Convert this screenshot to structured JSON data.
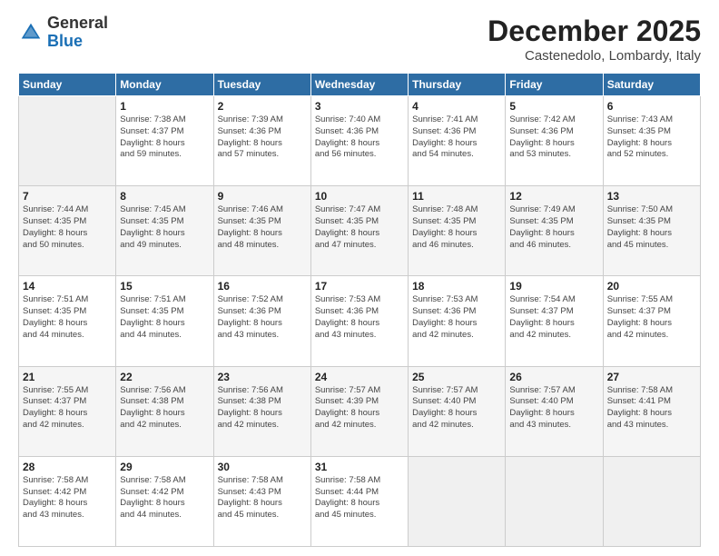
{
  "header": {
    "logo_general": "General",
    "logo_blue": "Blue",
    "month_title": "December 2025",
    "location": "Castenedolo, Lombardy, Italy"
  },
  "weekdays": [
    "Sunday",
    "Monday",
    "Tuesday",
    "Wednesday",
    "Thursday",
    "Friday",
    "Saturday"
  ],
  "weeks": [
    [
      {
        "day": "",
        "content": ""
      },
      {
        "day": "1",
        "content": "Sunrise: 7:38 AM\nSunset: 4:37 PM\nDaylight: 8 hours\nand 59 minutes."
      },
      {
        "day": "2",
        "content": "Sunrise: 7:39 AM\nSunset: 4:36 PM\nDaylight: 8 hours\nand 57 minutes."
      },
      {
        "day": "3",
        "content": "Sunrise: 7:40 AM\nSunset: 4:36 PM\nDaylight: 8 hours\nand 56 minutes."
      },
      {
        "day": "4",
        "content": "Sunrise: 7:41 AM\nSunset: 4:36 PM\nDaylight: 8 hours\nand 54 minutes."
      },
      {
        "day": "5",
        "content": "Sunrise: 7:42 AM\nSunset: 4:36 PM\nDaylight: 8 hours\nand 53 minutes."
      },
      {
        "day": "6",
        "content": "Sunrise: 7:43 AM\nSunset: 4:35 PM\nDaylight: 8 hours\nand 52 minutes."
      }
    ],
    [
      {
        "day": "7",
        "content": "Sunrise: 7:44 AM\nSunset: 4:35 PM\nDaylight: 8 hours\nand 50 minutes."
      },
      {
        "day": "8",
        "content": "Sunrise: 7:45 AM\nSunset: 4:35 PM\nDaylight: 8 hours\nand 49 minutes."
      },
      {
        "day": "9",
        "content": "Sunrise: 7:46 AM\nSunset: 4:35 PM\nDaylight: 8 hours\nand 48 minutes."
      },
      {
        "day": "10",
        "content": "Sunrise: 7:47 AM\nSunset: 4:35 PM\nDaylight: 8 hours\nand 47 minutes."
      },
      {
        "day": "11",
        "content": "Sunrise: 7:48 AM\nSunset: 4:35 PM\nDaylight: 8 hours\nand 46 minutes."
      },
      {
        "day": "12",
        "content": "Sunrise: 7:49 AM\nSunset: 4:35 PM\nDaylight: 8 hours\nand 46 minutes."
      },
      {
        "day": "13",
        "content": "Sunrise: 7:50 AM\nSunset: 4:35 PM\nDaylight: 8 hours\nand 45 minutes."
      }
    ],
    [
      {
        "day": "14",
        "content": "Sunrise: 7:51 AM\nSunset: 4:35 PM\nDaylight: 8 hours\nand 44 minutes."
      },
      {
        "day": "15",
        "content": "Sunrise: 7:51 AM\nSunset: 4:35 PM\nDaylight: 8 hours\nand 44 minutes."
      },
      {
        "day": "16",
        "content": "Sunrise: 7:52 AM\nSunset: 4:36 PM\nDaylight: 8 hours\nand 43 minutes."
      },
      {
        "day": "17",
        "content": "Sunrise: 7:53 AM\nSunset: 4:36 PM\nDaylight: 8 hours\nand 43 minutes."
      },
      {
        "day": "18",
        "content": "Sunrise: 7:53 AM\nSunset: 4:36 PM\nDaylight: 8 hours\nand 42 minutes."
      },
      {
        "day": "19",
        "content": "Sunrise: 7:54 AM\nSunset: 4:37 PM\nDaylight: 8 hours\nand 42 minutes."
      },
      {
        "day": "20",
        "content": "Sunrise: 7:55 AM\nSunset: 4:37 PM\nDaylight: 8 hours\nand 42 minutes."
      }
    ],
    [
      {
        "day": "21",
        "content": "Sunrise: 7:55 AM\nSunset: 4:37 PM\nDaylight: 8 hours\nand 42 minutes."
      },
      {
        "day": "22",
        "content": "Sunrise: 7:56 AM\nSunset: 4:38 PM\nDaylight: 8 hours\nand 42 minutes."
      },
      {
        "day": "23",
        "content": "Sunrise: 7:56 AM\nSunset: 4:38 PM\nDaylight: 8 hours\nand 42 minutes."
      },
      {
        "day": "24",
        "content": "Sunrise: 7:57 AM\nSunset: 4:39 PM\nDaylight: 8 hours\nand 42 minutes."
      },
      {
        "day": "25",
        "content": "Sunrise: 7:57 AM\nSunset: 4:40 PM\nDaylight: 8 hours\nand 42 minutes."
      },
      {
        "day": "26",
        "content": "Sunrise: 7:57 AM\nSunset: 4:40 PM\nDaylight: 8 hours\nand 43 minutes."
      },
      {
        "day": "27",
        "content": "Sunrise: 7:58 AM\nSunset: 4:41 PM\nDaylight: 8 hours\nand 43 minutes."
      }
    ],
    [
      {
        "day": "28",
        "content": "Sunrise: 7:58 AM\nSunset: 4:42 PM\nDaylight: 8 hours\nand 43 minutes."
      },
      {
        "day": "29",
        "content": "Sunrise: 7:58 AM\nSunset: 4:42 PM\nDaylight: 8 hours\nand 44 minutes."
      },
      {
        "day": "30",
        "content": "Sunrise: 7:58 AM\nSunset: 4:43 PM\nDaylight: 8 hours\nand 45 minutes."
      },
      {
        "day": "31",
        "content": "Sunrise: 7:58 AM\nSunset: 4:44 PM\nDaylight: 8 hours\nand 45 minutes."
      },
      {
        "day": "",
        "content": ""
      },
      {
        "day": "",
        "content": ""
      },
      {
        "day": "",
        "content": ""
      }
    ]
  ]
}
